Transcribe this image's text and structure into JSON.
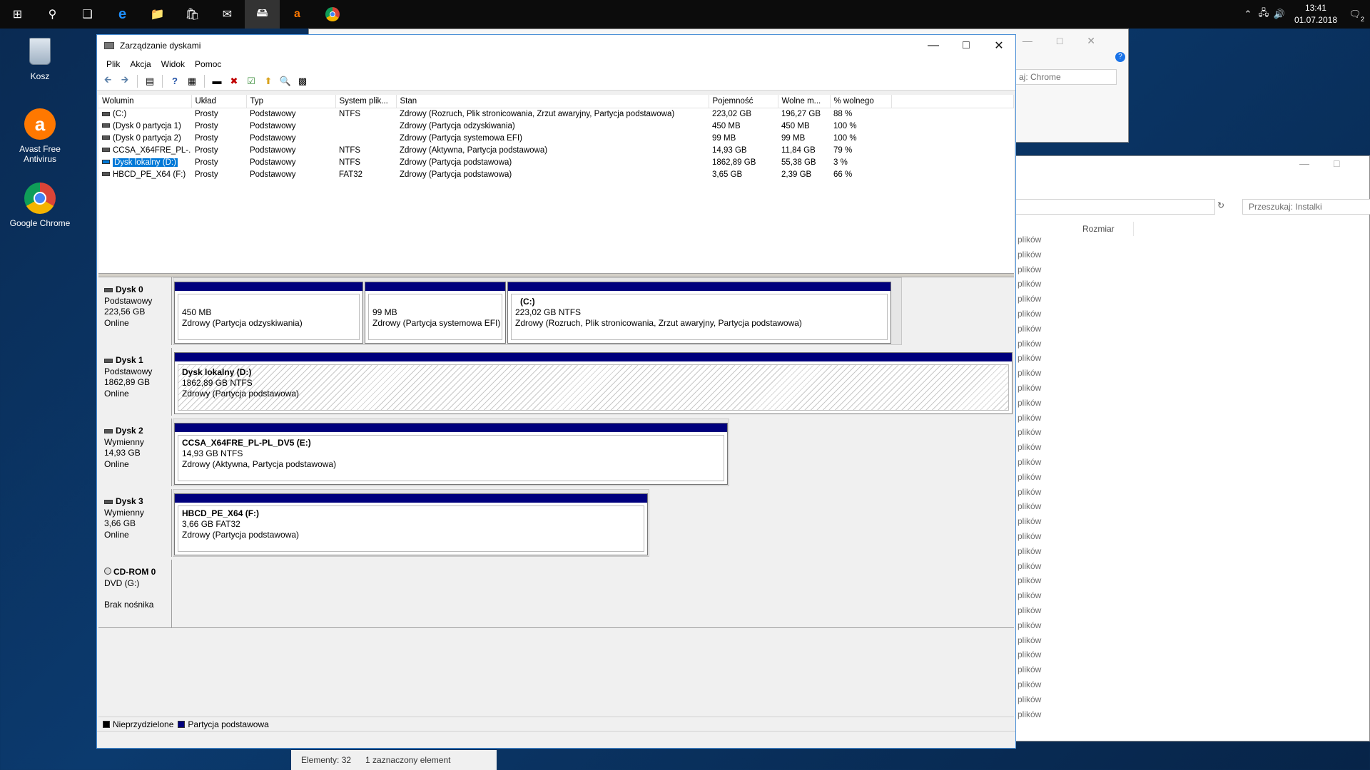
{
  "taskbar": {
    "time": "13:41",
    "date": "01.07.2018",
    "notification_count": "2"
  },
  "desktop": {
    "icons": [
      {
        "label": "Kosz"
      },
      {
        "label": "Avast Free Antivirus"
      },
      {
        "label": "Google Chrome"
      }
    ]
  },
  "background_windows": {
    "search_chrome": "aj: Chrome",
    "search_installs": "Przeszukaj: Instalki",
    "column_size": "Rozmiar",
    "repeated_item": "plików",
    "status_elements": "Elementy: 32",
    "status_selected": "1 zaznaczony element"
  },
  "window": {
    "title": "Zarządzanie dyskami",
    "menu": [
      "Plik",
      "Akcja",
      "Widok",
      "Pomoc"
    ]
  },
  "volumes": {
    "columns": [
      "Wolumin",
      "Układ",
      "Typ",
      "System plik...",
      "Stan",
      "Pojemność",
      "Wolne m...",
      "% wolnego"
    ],
    "rows": [
      [
        "(C:)",
        "Prosty",
        "Podstawowy",
        "NTFS",
        "Zdrowy (Rozruch, Plik stronicowania, Zrzut awaryjny, Partycja podstawowa)",
        "223,02 GB",
        "196,27 GB",
        "88 %"
      ],
      [
        "(Dysk 0 partycja 1)",
        "Prosty",
        "Podstawowy",
        "",
        "Zdrowy (Partycja odzyskiwania)",
        "450 MB",
        "450 MB",
        "100 %"
      ],
      [
        "(Dysk 0 partycja 2)",
        "Prosty",
        "Podstawowy",
        "",
        "Zdrowy (Partycja systemowa EFI)",
        "99 MB",
        "99 MB",
        "100 %"
      ],
      [
        "CCSA_X64FRE_PL-...",
        "Prosty",
        "Podstawowy",
        "NTFS",
        "Zdrowy (Aktywna, Partycja podstawowa)",
        "14,93 GB",
        "11,84 GB",
        "79 %"
      ],
      [
        "Dysk lokalny (D:)",
        "Prosty",
        "Podstawowy",
        "NTFS",
        "Zdrowy (Partycja podstawowa)",
        "1862,89 GB",
        "55,38 GB",
        "3 %"
      ],
      [
        "HBCD_PE_X64 (F:)",
        "Prosty",
        "Podstawowy",
        "FAT32",
        "Zdrowy (Partycja podstawowa)",
        "3,65 GB",
        "2,39 GB",
        "66 %"
      ]
    ],
    "selected_row": 4
  },
  "disks": [
    {
      "name": "Dysk 0",
      "kind": "Podstawowy",
      "size": "223,56 GB",
      "status": "Online",
      "partitions": [
        {
          "name": "",
          "size": "450 MB",
          "state": "Zdrowy (Partycja odzyskiwania)"
        },
        {
          "name": "",
          "size": "99 MB",
          "state": "Zdrowy (Partycja systemowa EFI)"
        },
        {
          "name": "(C:)",
          "size": "223,02 GB NTFS",
          "state": "Zdrowy (Rozruch, Plik stronicowania, Zrzut awaryjny, Partycja podstawowa)"
        }
      ]
    },
    {
      "name": "Dysk 1",
      "kind": "Podstawowy",
      "size": "1862,89 GB",
      "status": "Online",
      "partitions": [
        {
          "name": "Dysk lokalny  (D:)",
          "size": "1862,89 GB NTFS",
          "state": "Zdrowy (Partycja podstawowa)"
        }
      ]
    },
    {
      "name": "Dysk 2",
      "kind": "Wymienny",
      "size": "14,93 GB",
      "status": "Online",
      "partitions": [
        {
          "name": "CCSA_X64FRE_PL-PL_DV5  (E:)",
          "size": "14,93 GB NTFS",
          "state": "Zdrowy (Aktywna, Partycja podstawowa)"
        }
      ]
    },
    {
      "name": "Dysk 3",
      "kind": "Wymienny",
      "size": "3,66 GB",
      "status": "Online",
      "partitions": [
        {
          "name": "HBCD_PE_X64  (F:)",
          "size": "3,66 GB FAT32",
          "state": "Zdrowy (Partycja podstawowa)"
        }
      ]
    },
    {
      "name": "CD-ROM 0",
      "kind": "DVD (G:)",
      "size": "",
      "status": "Brak nośnika",
      "partitions": []
    }
  ],
  "legend": {
    "unallocated": "Nieprzydzielone",
    "primary": "Partycja podstawowa",
    "unallocated_color": "#000000",
    "primary_color": "#00007d"
  }
}
